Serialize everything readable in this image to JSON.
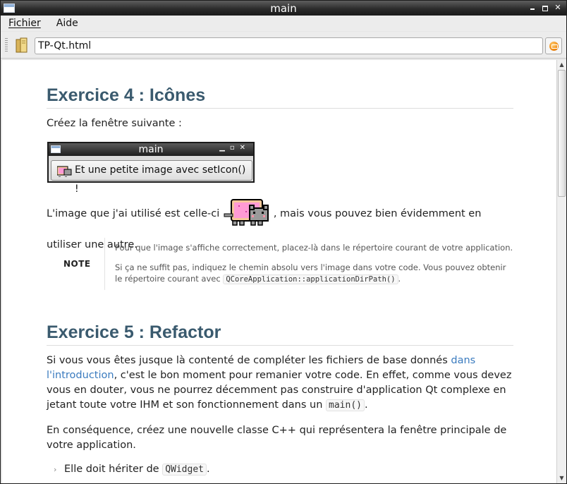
{
  "window": {
    "title": "main"
  },
  "menu": {
    "file": "Fichier",
    "help": "Aide"
  },
  "toolbar": {
    "url": "TP-Qt.html"
  },
  "section4": {
    "heading": "Exercice 4 : Icônes",
    "intro": "Créez la fenêtre suivante :",
    "sample_window_title": "main",
    "sample_button_label": "Et une petite image avec setIcon() !",
    "image_sentence_before": "L'image que j'ai utilisé est celle-ci",
    "image_sentence_after": ", mais vous pouvez bien évidemment en utiliser une autre.",
    "note": {
      "label": "NOTE",
      "line1": "Pour que l'image s'affiche correctement, placez-là dans le répertoire courant de votre application.",
      "line2_part1": "Si ça ne suffit pas, indiquez le chemin absolu vers l'image dans votre code. Vous pouvez obtenir le répertoire courant avec",
      "line2_code": "QCoreApplication::applicationDirPath()",
      "line2_end": "."
    }
  },
  "section5": {
    "heading": "Exercice 5 : Refactor",
    "p1_a": "Si vous vous êtes jusque là contenté de compléter les fichiers de base donnés",
    "p1_link": "dans l'introduction",
    "p1_b": ", c'est le bon moment pour remanier votre code. En effet, comme vous devez vous en douter, vous ne pourrez décemment pas construire d'application Qt complexe en jetant toute votre IHM et son fonctionnement dans un",
    "p1_code": "main()",
    "p1_end": ".",
    "p2": "En conséquence, créez une nouvelle classe C++ qui représentera la fenêtre principale de votre application.",
    "bullet1_text": "Elle doit hériter de",
    "bullet1_code": "QWidget",
    "bullet1_end": "."
  },
  "colors": {
    "heading": "#3a5a6e",
    "link": "#3a7bbf",
    "titlebar": "#2c2c2c"
  },
  "icons": [
    "app-window-icon",
    "minimize-icon",
    "maximize-icon",
    "close-icon",
    "book-icon",
    "stop-icon",
    "nyan-cat-icon",
    "bullet-chevron-icon"
  ]
}
